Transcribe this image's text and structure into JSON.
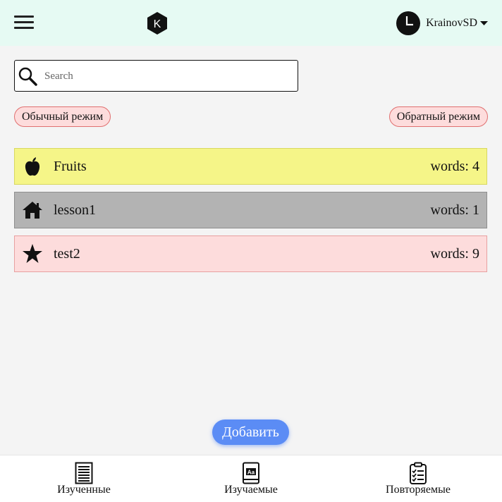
{
  "header": {
    "logo_letter": "K",
    "username": "KrainovSD",
    "bg_color": "#e6faf3"
  },
  "search": {
    "placeholder": "Search",
    "value": ""
  },
  "modes": {
    "normal": "Обычный режим",
    "reverse": "Обратный режим"
  },
  "lessons": [
    {
      "name": "Fruits",
      "count_label": "words:",
      "count": "4",
      "icon": "apple-icon",
      "color": "#f5f588"
    },
    {
      "name": "lesson1",
      "count_label": "words:",
      "count": "1",
      "icon": "house-icon",
      "color": "#b3b3b3"
    },
    {
      "name": "test2",
      "count_label": "words:",
      "count": "9",
      "icon": "star-icon",
      "color": "#fddcdc"
    }
  ],
  "add_button": "Добавить",
  "bottom_nav": [
    {
      "label": "Изученные",
      "icon": "list-document-icon"
    },
    {
      "label": "Изучаемые",
      "icon": "dictionary-book-icon"
    },
    {
      "label": "Повторяемые",
      "icon": "clipboard-checklist-icon"
    }
  ],
  "colors": {
    "accent": "#5b8cf5",
    "mode_bg": "#fddcdc",
    "mode_border": "#e07070"
  }
}
